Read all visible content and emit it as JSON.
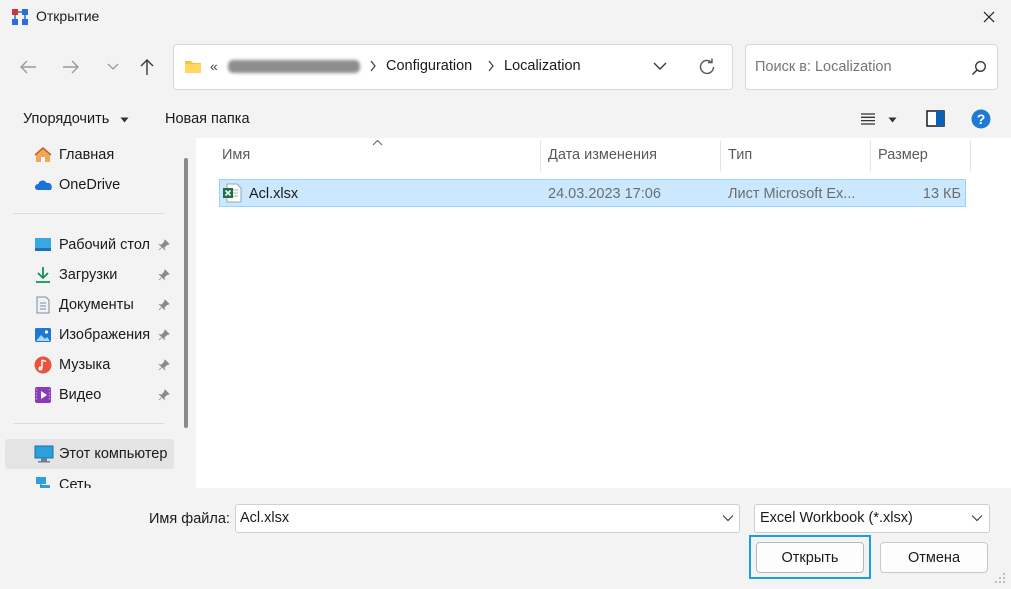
{
  "window": {
    "title": "Открытие"
  },
  "address": {
    "overflow": "«",
    "crumbs": [
      "Configuration",
      "Localization"
    ]
  },
  "search": {
    "placeholder": "Поиск в: Localization"
  },
  "toolbar": {
    "organize": "Упорядочить",
    "new_folder": "Новая папка"
  },
  "nav": {
    "items": [
      {
        "label": "Главная",
        "icon": "home-icon"
      },
      {
        "label": "OneDrive",
        "icon": "onedrive-icon"
      },
      {
        "label": "Рабочий стол",
        "icon": "desktop-icon",
        "pinned": true
      },
      {
        "label": "Загрузки",
        "icon": "downloads-icon",
        "pinned": true
      },
      {
        "label": "Документы",
        "icon": "documents-icon",
        "pinned": true
      },
      {
        "label": "Изображения",
        "icon": "pictures-icon",
        "pinned": true
      },
      {
        "label": "Музыка",
        "icon": "music-icon",
        "pinned": true
      },
      {
        "label": "Видео",
        "icon": "videos-icon",
        "pinned": true
      },
      {
        "label": "Этот компьютер",
        "icon": "this-pc-icon",
        "selected": true
      },
      {
        "label": "Сеть",
        "icon": "network-icon"
      }
    ]
  },
  "columns": {
    "name": "Имя",
    "date": "Дата изменения",
    "type": "Тип",
    "size": "Размер"
  },
  "files": [
    {
      "name": "Acl.xlsx",
      "date": "24.03.2023 17:06",
      "type": "Лист Microsoft Ex...",
      "size": "13 КБ",
      "selected": true
    }
  ],
  "footer": {
    "filename_label": "Имя файла:",
    "filename_value": "Acl.xlsx",
    "filter": "Excel Workbook (*.xlsx)",
    "open": "Открыть",
    "cancel": "Отмена"
  },
  "colors": {
    "accent": "#0067c0",
    "selection": "#cce8ff",
    "focus": "#1e9de0"
  }
}
